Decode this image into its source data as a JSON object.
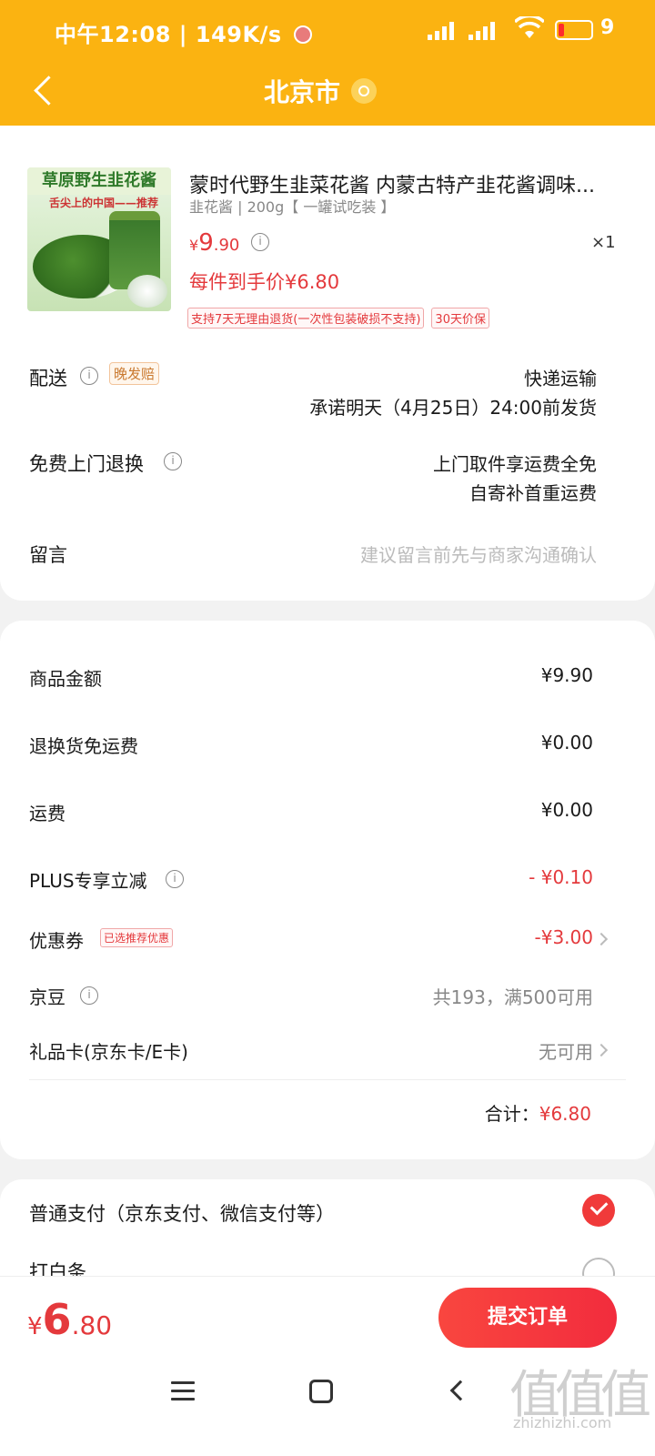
{
  "status_bar": {
    "time": "中午12:08",
    "speed": "149K/s",
    "battery_text": "9"
  },
  "header": {
    "title": "北京市"
  },
  "product": {
    "image_text": "草原野生韭花酱",
    "image_subtext": "舌尖上的中国——推荐",
    "title": "蒙时代野生韭菜花酱 内蒙古特产韭花酱调味...",
    "spec": "韭花酱 | 200g【 一罐试吃装 】",
    "price_currency": "¥",
    "price_int": "9",
    "price_dec": ".90",
    "quantity": "×1",
    "final_price": "每件到手价¥6.80",
    "tags": [
      "支持7天无理由退货(一次性包装破损不支持)",
      "30天价保"
    ]
  },
  "delivery": {
    "label": "配送",
    "badge": "晚发赔",
    "method": "快递运输",
    "promise": "承诺明天（4月25日）24:00前发货"
  },
  "free_return": {
    "label": "免费上门退换",
    "line1": "上门取件享运费全免",
    "line2": "自寄补首重运费"
  },
  "message": {
    "label": "留言",
    "placeholder": "建议留言前先与商家沟通确认"
  },
  "fees": {
    "goods_label": "商品金额",
    "goods_value": "¥9.90",
    "return_label": "退换货免运费",
    "return_value": "¥0.00",
    "shipping_label": "运费",
    "shipping_value": "¥0.00",
    "plus_label": "PLUS专享立减",
    "plus_value": "- ¥0.10",
    "coupon_label": "优惠券",
    "coupon_tag": "已选推荐优惠",
    "coupon_value": "-¥3.00",
    "jd_bean_label": "京豆",
    "jd_bean_value": "共193，满500可用",
    "gift_card_label": "礼品卡(京东卡/E卡)",
    "gift_card_value": "无可用",
    "total_label": "合计：",
    "total_value": "¥6.80"
  },
  "payment": {
    "option1": "普通支付（京东支付、微信支付等）",
    "option2": "打白条"
  },
  "bottom": {
    "currency": "¥",
    "total_int": "6",
    "total_dec": ".80",
    "submit": "提交订单"
  },
  "watermark": {
    "glyph": "值值值",
    "text": "zhizhizhi.com"
  },
  "colors": {
    "brand_yellow": "#fbb311",
    "price_red": "#e4393c",
    "button_red": "#f22c3d"
  }
}
